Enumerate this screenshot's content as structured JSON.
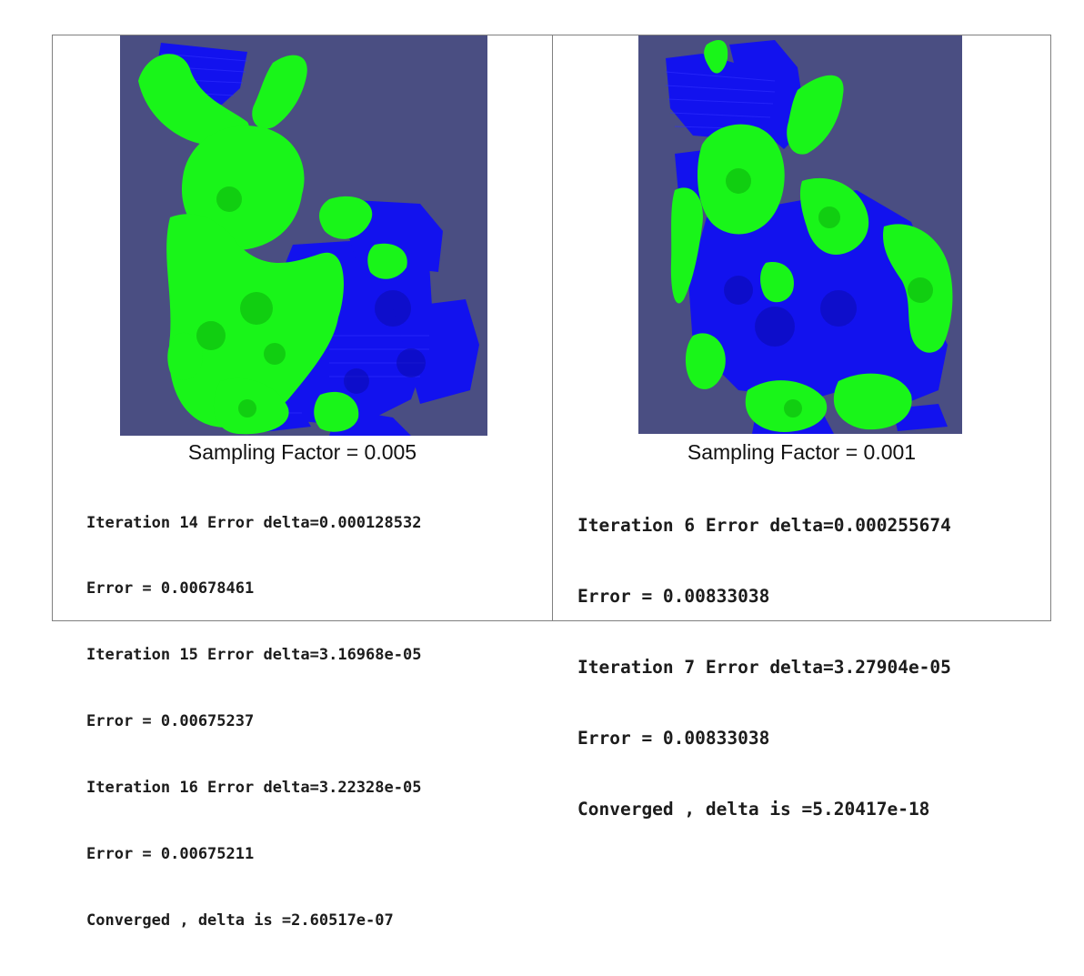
{
  "panels": [
    {
      "caption": "Sampling Factor = 0.005",
      "log": [
        "Iteration 14 Error delta=0.000128532",
        "Error = 0.00678461",
        "Iteration 15 Error delta=3.16968e-05",
        "Error = 0.00675237",
        "Iteration 16 Error delta=3.22328e-05",
        "Error = 0.00675211",
        "Converged , delta is =2.60517e-07"
      ]
    },
    {
      "caption": "Sampling Factor = 0.001",
      "log": [
        "Iteration 6 Error delta=0.000255674",
        "Error = 0.00833038",
        "Iteration 7 Error delta=3.27904e-05",
        "Error = 0.00833038",
        "Converged , delta is =5.20417e-18"
      ]
    }
  ],
  "colors": {
    "background": "#4a4e82",
    "mesh_green": "#19f519",
    "mesh_blue": "#1010f0"
  }
}
